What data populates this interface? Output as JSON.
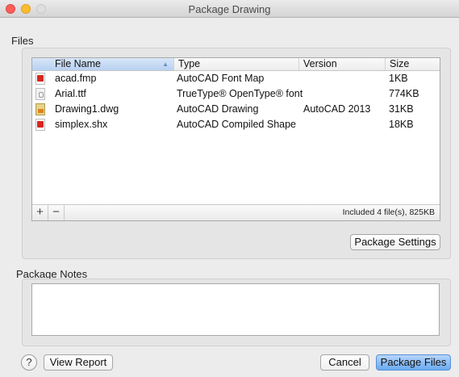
{
  "window": {
    "title": "Package Drawing"
  },
  "files_section": {
    "label": "Files"
  },
  "table": {
    "columns": [
      "File Name",
      "Type",
      "Version",
      "Size"
    ],
    "rows": [
      {
        "icon": "pdf-file-icon",
        "name": "acad.fmp",
        "type": "AutoCAD Font Map",
        "version": "",
        "size": "1KB"
      },
      {
        "icon": "font-file-icon",
        "name": "Arial.ttf",
        "type": "TrueType® OpenType® font",
        "version": "",
        "size": "774KB"
      },
      {
        "icon": "dwg-file-icon",
        "name": "Drawing1.dwg",
        "type": "AutoCAD Drawing",
        "version": "AutoCAD 2013",
        "size": "31KB"
      },
      {
        "icon": "pdf-file-icon",
        "name": "simplex.shx",
        "type": "AutoCAD Compiled Shape",
        "version": "",
        "size": "18KB"
      }
    ],
    "add_label": "+",
    "remove_label": "−",
    "status": "Included 4 file(s), 825KB"
  },
  "package_settings_label": "Package Settings",
  "notes_section": {
    "label": "Package Notes",
    "value": ""
  },
  "footer": {
    "help_label": "?",
    "view_report_label": "View Report",
    "cancel_label": "Cancel",
    "package_files_label": "Package Files"
  }
}
